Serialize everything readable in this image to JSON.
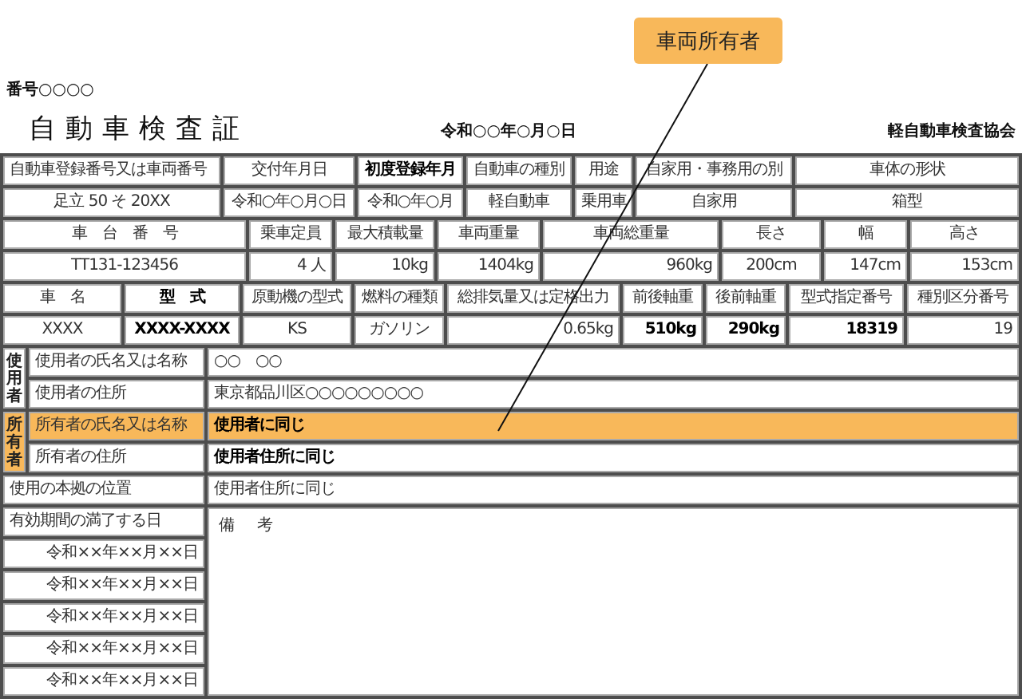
{
  "header": {
    "number": "番号○○○○",
    "title": "自動車検査証",
    "date": "令和○○年○月○日",
    "issuer": "軽自動車検査協会"
  },
  "callout": {
    "label": "車両所有者"
  },
  "spec_blocks": [
    {
      "headers": [
        {
          "text": "自動車登録番号又は車両番号",
          "emphasis": false
        },
        {
          "text": "交付年月日",
          "emphasis": false
        },
        {
          "text": "初度登録年月",
          "emphasis": true
        },
        {
          "text": "自動車の種別",
          "emphasis": false
        },
        {
          "text": "用途",
          "emphasis": false
        },
        {
          "text": "自家用・事務用の別",
          "emphasis": false
        },
        {
          "text": "車体の形状",
          "emphasis": false
        }
      ],
      "values": [
        {
          "text": "足立 50 そ 20XX",
          "emphasis": false
        },
        {
          "text": "令和○年○月○日",
          "emphasis": false
        },
        {
          "text": "令和○年○月",
          "emphasis": false
        },
        {
          "text": "軽自動車",
          "emphasis": false
        },
        {
          "text": "乗用車",
          "emphasis": false
        },
        {
          "text": "自家用",
          "emphasis": false
        },
        {
          "text": "箱型",
          "emphasis": false
        }
      ]
    },
    {
      "headers": [
        {
          "text": "車　台　番　号",
          "emphasis": false
        },
        {
          "text": "乗車定員",
          "emphasis": false
        },
        {
          "text": "最大積載量",
          "emphasis": false
        },
        {
          "text": "車両重量",
          "emphasis": false
        },
        {
          "text": "車両総重量",
          "emphasis": false
        },
        {
          "text": "長さ",
          "emphasis": false
        },
        {
          "text": "幅",
          "emphasis": false
        },
        {
          "text": "高さ",
          "emphasis": false
        }
      ],
      "values": [
        {
          "text": "TT131-123456",
          "emphasis": false
        },
        {
          "text": "4 人",
          "emphasis": false
        },
        {
          "text": "10kg",
          "emphasis": false
        },
        {
          "text": "1404kg",
          "emphasis": false
        },
        {
          "text": "960kg",
          "emphasis": false
        },
        {
          "text": "200cm",
          "emphasis": false
        },
        {
          "text": "147cm",
          "emphasis": false
        },
        {
          "text": "153cm",
          "emphasis": false
        }
      ]
    },
    {
      "headers": [
        {
          "text": "車　名",
          "emphasis": false
        },
        {
          "text": "型　式",
          "emphasis": true
        },
        {
          "text": "原動機の型式",
          "emphasis": false
        },
        {
          "text": "燃料の種類",
          "emphasis": false
        },
        {
          "text": "総排気量又は定格出力",
          "emphasis": false
        },
        {
          "text": "前後軸重",
          "emphasis": false
        },
        {
          "text": "後前軸重",
          "emphasis": false
        },
        {
          "text": "型式指定番号",
          "emphasis": false
        },
        {
          "text": "種別区分番号",
          "emphasis": false
        }
      ],
      "values": [
        {
          "text": "XXXX",
          "emphasis": false
        },
        {
          "text": "XXXX-XXXX",
          "emphasis": true
        },
        {
          "text": "KS",
          "emphasis": false
        },
        {
          "text": "ガソリン",
          "emphasis": false
        },
        {
          "text": "0.65kg",
          "emphasis": false
        },
        {
          "text": "510kg",
          "emphasis": true
        },
        {
          "text": "290kg",
          "emphasis": true
        },
        {
          "text": "18319",
          "emphasis": true
        },
        {
          "text": "19",
          "emphasis": false
        }
      ]
    }
  ],
  "parties": [
    {
      "group": "使用者",
      "highlighted": false,
      "rows": [
        {
          "label": "使用者の氏名又は名称",
          "value": "○○　○○",
          "highlighted": false,
          "emphasis": false
        },
        {
          "label": "使用者の住所",
          "value": "東京都品川区○○○○○○○○○",
          "highlighted": false,
          "emphasis": false
        }
      ]
    },
    {
      "group": "所有者",
      "highlighted": true,
      "rows": [
        {
          "label": "所有者の氏名又は名称",
          "value": "使用者に同じ",
          "highlighted": true,
          "emphasis": true
        },
        {
          "label": "所有者の住所",
          "value": "使用者住所に同じ",
          "highlighted": false,
          "emphasis": true
        }
      ]
    }
  ],
  "base_location": {
    "label": "使用の本拠の位置",
    "value": "使用者住所に同じ"
  },
  "expiry": {
    "label": "有効期間の満了する日",
    "dates": [
      "令和××年××月××日",
      "令和××年××月××日",
      "令和××年××月××日",
      "令和××年××月××日",
      "令和××年××月××日"
    ]
  },
  "remarks": {
    "label": "備　考"
  }
}
